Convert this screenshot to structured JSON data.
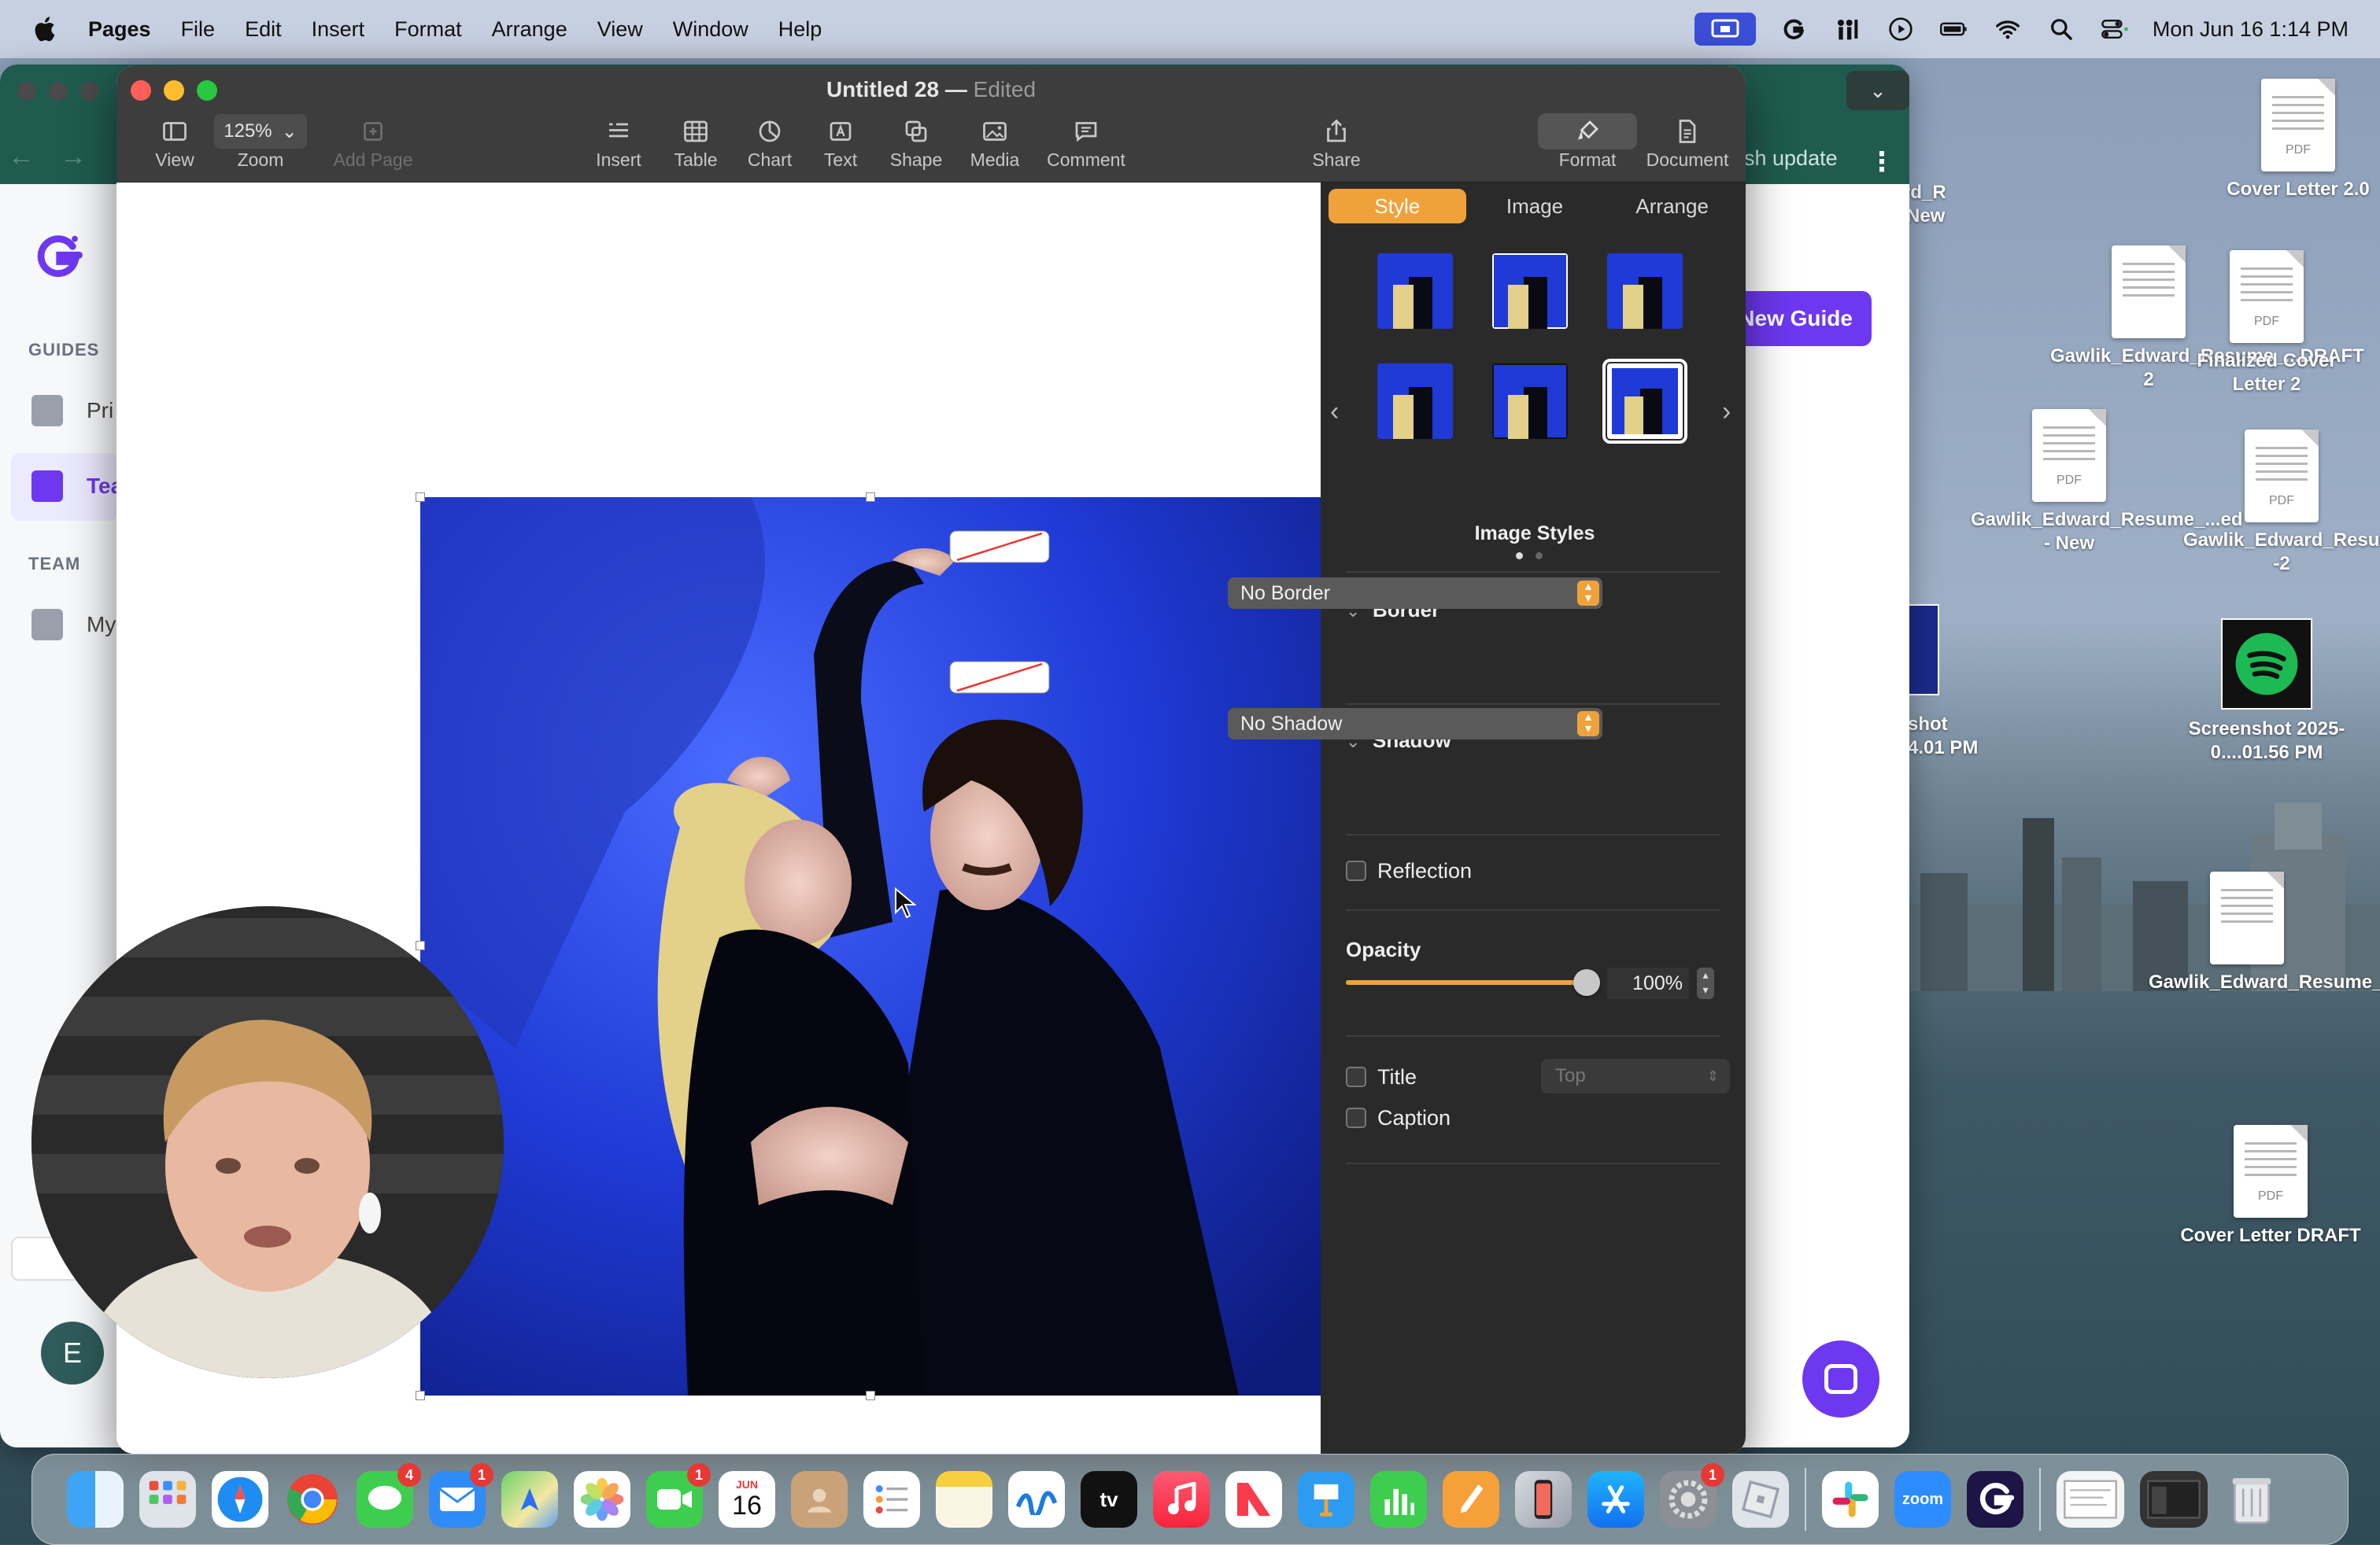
{
  "menubar": {
    "app_name": "Pages",
    "menus": [
      "File",
      "Edit",
      "Insert",
      "Format",
      "Arrange",
      "View",
      "Window",
      "Help"
    ],
    "clock": "Mon Jun 16  1:14 PM"
  },
  "desktop_files": [
    {
      "label": "Cover Letter 2.0",
      "badge": "PDF"
    },
    {
      "label": "Gawlik_Edward_Resume_...DRAFT 2",
      "badge": ""
    },
    {
      "label": "Finalized Cover Letter 2",
      "badge": "PDF"
    },
    {
      "label": "Gawlik_Edward_Resume_...ed - New",
      "badge": "PDF"
    },
    {
      "label": "Gawlik_Edward_Resume_Finalized -2",
      "badge": "PDF"
    },
    {
      "label": "Screenshot 2025-0....01.56 PM",
      "badge": ""
    },
    {
      "label": "Gawlik_Edward_Resume_Finalized",
      "badge": ""
    },
    {
      "label": "Cover Letter DRAFT",
      "badge": "PDF"
    }
  ],
  "bg_app": {
    "sections": {
      "guides": "GUIDES",
      "team": "TEAM"
    },
    "items": {
      "guide1": "Pri",
      "guide2": "Tea",
      "team1": "My"
    },
    "header_action": "ish update",
    "new_guide": "New Guide",
    "avatar_letter": "E",
    "partial_labels": {
      "file_a": "ward_R\nd - New",
      "file_b": "shot\n4.01 PM"
    }
  },
  "pages": {
    "title": "Untitled 28",
    "status": "Edited",
    "zoom_value": "125%",
    "toolbar": {
      "view": "View",
      "zoom": "Zoom",
      "add_page": "Add Page",
      "insert": "Insert",
      "table": "Table",
      "chart": "Chart",
      "text": "Text",
      "shape": "Shape",
      "media": "Media",
      "comment": "Comment",
      "share": "Share",
      "format": "Format",
      "document": "Document"
    },
    "inspector": {
      "tabs": [
        "Style",
        "Image",
        "Arrange"
      ],
      "active_tab": "Style",
      "image_styles_label": "Image Styles",
      "border_label": "Border",
      "border_value": "No Border",
      "shadow_label": "Shadow",
      "shadow_value": "No Shadow",
      "reflection_label": "Reflection",
      "opacity_label": "Opacity",
      "opacity_value": "100%",
      "opacity_level": 1.0,
      "title_label": "Title",
      "title_position": "Top",
      "caption_label": "Caption"
    }
  },
  "dock": {
    "apps": [
      "Finder",
      "Launchpad",
      "Safari",
      "Chrome",
      "Messages",
      "Mail",
      "Maps",
      "Photos",
      "FaceTime",
      "Calendar",
      "Contacts",
      "Reminders",
      "Notes",
      "Freeform",
      "TV",
      "Music",
      "News",
      "Keynote",
      "Numbers",
      "Pages",
      "iPhone Mirroring",
      "App Store",
      "System Settings",
      "Roblox",
      "Slack",
      "Zoom",
      "Guidde"
    ],
    "calendar_month": "JUN",
    "calendar_day": "16",
    "badges": {
      "messages": "4",
      "mail": "1",
      "facetime": "1",
      "settings": "1"
    },
    "zoom_label": "zoom"
  },
  "colors": {
    "accent": "#f0a23a",
    "bg_app_accent": "#6d38f0",
    "toolbar_bg": "#3d3d3d",
    "inspector_bg": "#2a2a2a"
  }
}
